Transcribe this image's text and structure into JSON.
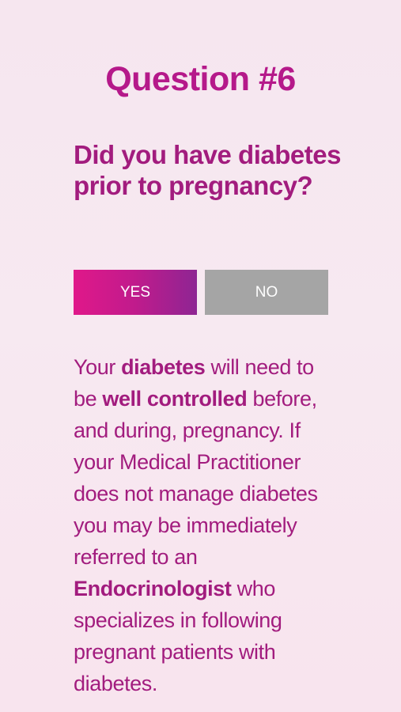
{
  "question": {
    "number_label": "Question #6",
    "text": "Did you have diabetes prior to pregnancy?"
  },
  "answers": {
    "yes_label": "YES",
    "no_label": "NO",
    "selected": "YES"
  },
  "info": {
    "part1": "Your ",
    "bold1": "diabetes",
    "part2": " will need to be ",
    "bold2": "well controlled",
    "part3": " before, and during, pregnancy. If your Medical Practitioner does not manage diabetes you may be immediately referred to an ",
    "bold3": "Endocrinologist",
    "part4": " who specializes in following pregnant patients with diabetes."
  },
  "colors": {
    "accent": "#b5198a",
    "text": "#a21c7e",
    "yes_gradient_start": "#e0188a",
    "yes_gradient_end": "#8e2593",
    "no_button": "#a5a5a5",
    "background": "#f6e6ef"
  }
}
